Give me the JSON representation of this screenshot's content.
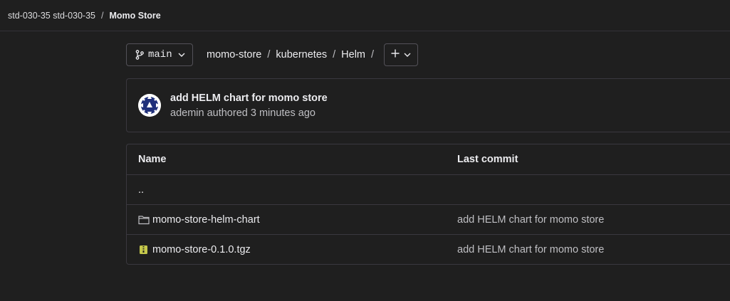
{
  "breadcrumb": {
    "group": "std-030-35 std-030-35",
    "separator": "/",
    "project": "Momo Store"
  },
  "nav": {
    "branch": "main",
    "path": [
      {
        "label": "momo-store"
      },
      {
        "label": "kubernetes"
      },
      {
        "label": "Helm"
      }
    ],
    "path_separator": "/"
  },
  "last_commit": {
    "title": "add HELM chart for momo store",
    "author_line": "ademin authored 3 minutes ago"
  },
  "table": {
    "headers": {
      "name": "Name",
      "last_commit": "Last commit"
    },
    "parent": "..",
    "rows": [
      {
        "name": "momo-store-helm-chart",
        "icon": "folder-icon",
        "commit": "add HELM chart for momo store"
      },
      {
        "name": "momo-store-0.1.0.tgz",
        "icon": "archive-file-icon",
        "commit": "add HELM chart for momo store"
      }
    ]
  },
  "colors": {
    "background": "#1f1f1f",
    "border": "#3a383f",
    "text": "#ececef",
    "muted_text": "#bfbfc3",
    "archive_icon": "#c5c84b",
    "avatar_blue": "#1f2f7a"
  }
}
